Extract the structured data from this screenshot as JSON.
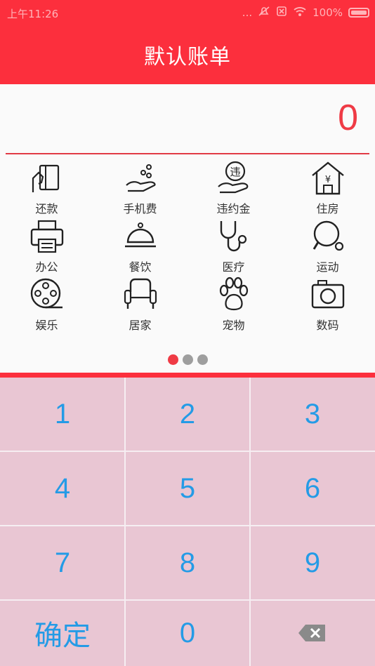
{
  "status": {
    "time": "上午11:26",
    "dots": "...",
    "battery_text": "100%"
  },
  "header": {
    "title": "默认账单"
  },
  "amount": {
    "value": "0"
  },
  "categories": [
    {
      "label": "还款",
      "icon": "card-hand-icon"
    },
    {
      "label": "手机费",
      "icon": "coins-hand-icon"
    },
    {
      "label": "违约金",
      "icon": "penalty-hand-icon"
    },
    {
      "label": "住房",
      "icon": "house-yuan-icon"
    },
    {
      "label": "办公",
      "icon": "printer-icon"
    },
    {
      "label": "餐饮",
      "icon": "food-dome-icon"
    },
    {
      "label": "医疗",
      "icon": "stethoscope-icon"
    },
    {
      "label": "运动",
      "icon": "pingpong-icon"
    },
    {
      "label": "娱乐",
      "icon": "film-reel-icon"
    },
    {
      "label": "居家",
      "icon": "armchair-icon"
    },
    {
      "label": "宠物",
      "icon": "paw-icon"
    },
    {
      "label": "数码",
      "icon": "camera-icon"
    }
  ],
  "pager": {
    "pages": 3,
    "active": 0
  },
  "keypad": {
    "keys": [
      "1",
      "2",
      "3",
      "4",
      "5",
      "6",
      "7",
      "8",
      "9",
      "确定",
      "0"
    ],
    "backspace_icon": "backspace-icon"
  },
  "colors": {
    "brand_red": "#fc2f3d",
    "amount_red": "#ef3b45",
    "key_blue": "#249be6",
    "keypad_bg": "#e9c6d3"
  }
}
